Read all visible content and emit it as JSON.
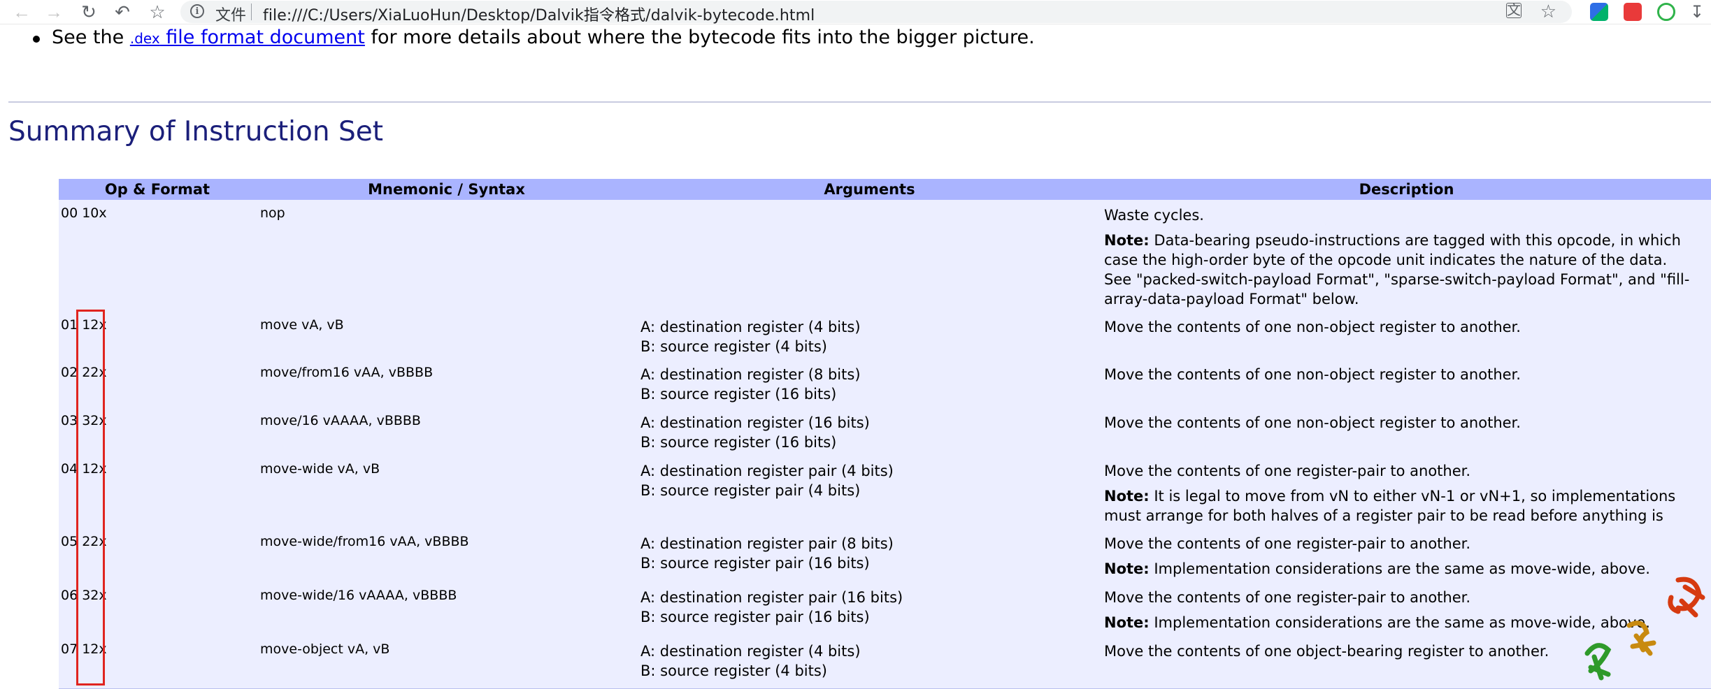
{
  "browser": {
    "scheme_label": "文件",
    "url": "file:///C:/Users/XiaLuoHun/Desktop/Dalvik指令格式/dalvik-bytecode.html"
  },
  "page": {
    "bullet": {
      "prefix": "See the ",
      "link_code": ".dex",
      "link_text": " file format document",
      "suffix": " for more details about where the bytecode fits into the bigger picture."
    },
    "section_title": "Summary of Instruction Set",
    "table": {
      "headers": [
        "Op & Format",
        "Mnemonic / Syntax",
        "Arguments",
        "Description"
      ],
      "rows": [
        {
          "op": "00 10x",
          "mnemonic": "nop",
          "args": [],
          "desc": [
            {
              "note": "",
              "text": "Waste cycles."
            },
            {
              "note": "Note:",
              "text": " Data-bearing pseudo-instructions are tagged with this opcode, in which case the high-order byte of the opcode unit indicates the nature of the data. See \"packed-switch-payload Format\", \"sparse-switch-payload Format\", and \"fill-array-data-payload Format\" below."
            }
          ]
        },
        {
          "op": "01 12x",
          "mnemonic": "move vA, vB",
          "args": [
            "A: destination register (4 bits)",
            "B: source register (4 bits)"
          ],
          "desc": [
            {
              "note": "",
              "text": "Move the contents of one non-object register to another."
            }
          ]
        },
        {
          "op": "02 22x",
          "mnemonic": "move/from16 vAA, vBBBB",
          "args": [
            "A: destination register (8 bits)",
            "B: source register (16 bits)"
          ],
          "desc": [
            {
              "note": "",
              "text": "Move the contents of one non-object register to another."
            }
          ]
        },
        {
          "op": "03 32x",
          "mnemonic": "move/16 vAAAA, vBBBB",
          "args": [
            "A: destination register (16 bits)",
            "B: source register (16 bits)"
          ],
          "desc": [
            {
              "note": "",
              "text": "Move the contents of one non-object register to another."
            }
          ]
        },
        {
          "op": "04 12x",
          "mnemonic": "move-wide vA, vB",
          "args": [
            "A: destination register pair (4 bits)",
            "B: source register pair (4 bits)"
          ],
          "desc": [
            {
              "note": "",
              "text": "Move the contents of one register-pair to another."
            },
            {
              "note": "Note:",
              "text": " It is legal to move from vN to either vN-1 or vN+1, so implementations must arrange for both halves of a register pair to be read before anything is written."
            }
          ]
        },
        {
          "op": "05 22x",
          "mnemonic": "move-wide/from16 vAA, vBBBB",
          "args": [
            "A: destination register pair (8 bits)",
            "B: source register pair (16 bits)"
          ],
          "desc": [
            {
              "note": "",
              "text": "Move the contents of one register-pair to another."
            },
            {
              "note": "Note:",
              "text": " Implementation considerations are the same as move-wide, above."
            }
          ]
        },
        {
          "op": "06 32x",
          "mnemonic": "move-wide/16 vAAAA, vBBBB",
          "args": [
            "A: destination register pair (16 bits)",
            "B: source register pair (16 bits)"
          ],
          "desc": [
            {
              "note": "",
              "text": "Move the contents of one register-pair to another."
            },
            {
              "note": "Note:",
              "text": " Implementation considerations are the same as move-wide, above."
            }
          ]
        },
        {
          "op": "07 12x",
          "mnemonic": "move-object vA, vB",
          "args": [
            "A: destination register (4 bits)",
            "B: source register (4 bits)"
          ],
          "desc": [
            {
              "note": "",
              "text": "Move the contents of one object-bearing register to another."
            }
          ]
        }
      ]
    }
  },
  "colors": {
    "header_bg": "#aab4ff",
    "row_bg": "#eceeff",
    "title": "#1b1f7a",
    "highlight_box": "#e0241f"
  }
}
